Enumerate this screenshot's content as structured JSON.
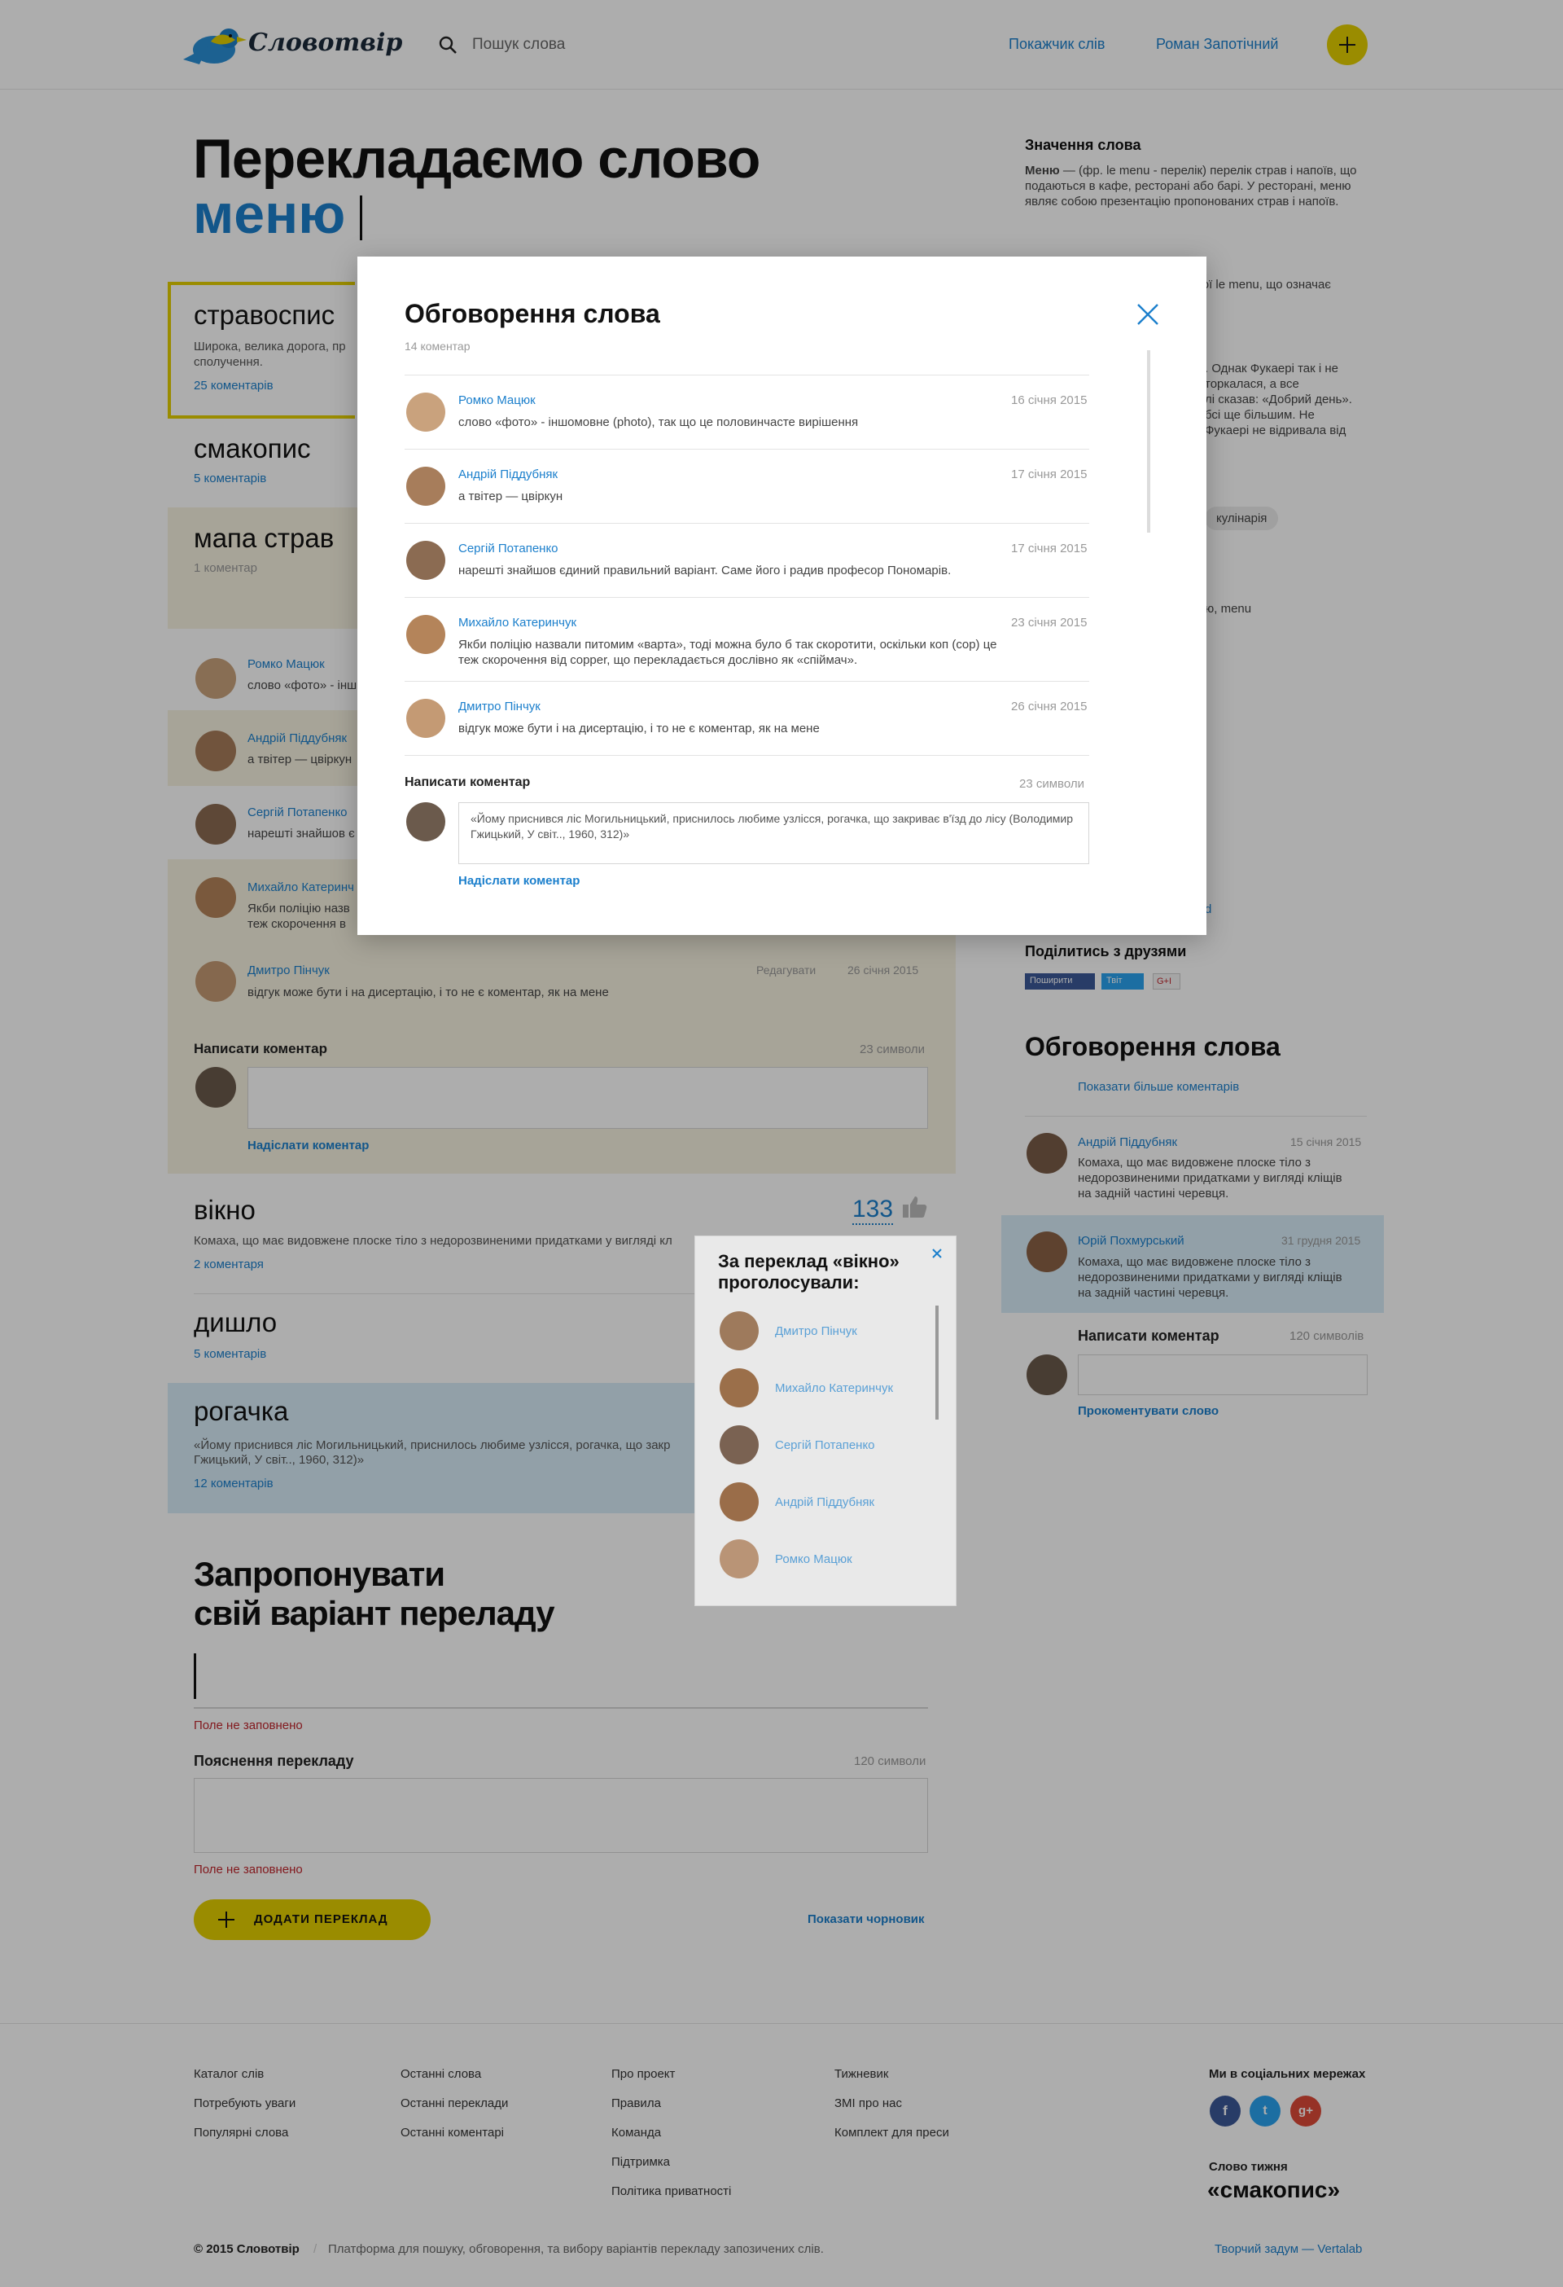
{
  "header": {
    "logo_text": "Словотвір",
    "search_placeholder": "Пошук слова",
    "nav": [
      "Покажчик слів",
      "Роман Запотічний"
    ]
  },
  "main": {
    "title_line1": "Перекладаємо слово",
    "title_word": "меню",
    "cards": [
      {
        "title": "стравоспис",
        "desc": "Широка, велика дорога, пр",
        "desc2": "сполучення.",
        "link": "25 коментарів"
      },
      {
        "title": "смакопис",
        "link": "5 коментарів"
      },
      {
        "title": "мапа страв",
        "link": "1 коментар"
      }
    ],
    "expanded_comments": [
      {
        "name": "Ромко Мацюк",
        "text": "слово «фото» - інш"
      },
      {
        "name": "Андрій Піддубняк",
        "text": "а твітер — цвіркун"
      },
      {
        "name": "Сергій Потапенко",
        "text": "нарешті знайшов є"
      },
      {
        "name": "Михайло Катеринч",
        "text": "Якби поліцію назв",
        "text2": "теж скорочення в"
      },
      {
        "name": "Дмитро Пінчук",
        "text": "відгук може бути і на дисертацію, і то не є коментар, як на мене",
        "edit": "Редагувати",
        "date": "26 січня 2015"
      }
    ],
    "write_comment_label": "Написати коментар",
    "write_comment_counter": "23 символи",
    "send_comment": "Надіслати коментар",
    "cards2": [
      {
        "title": "вікно",
        "desc": "Комаха, що має видовжене плоске тіло з недорозвиненими придатками у вигляді кл",
        "link": "2 коментаря",
        "votes": "133"
      },
      {
        "title": "дишло",
        "link": "5 коментарів"
      },
      {
        "title": "рогачка",
        "desc": "«Йому приснився ліс Могильницький, приснилось любиме узлісся, рогачка, що закр",
        "desc2": "Гжицький, У світ.., 1960, 312)»",
        "link": "12 коментарів"
      }
    ],
    "propose_title1": "Запропонувати",
    "propose_title2": "свій варіант переладу",
    "field_error": "Поле не заповнено",
    "explain_label": "Пояснення перекладу",
    "explain_counter": "120 символи",
    "add_button": "ДОДАТИ ПЕРЕКЛАД",
    "show_draft": "Показати чорновик"
  },
  "sidebar": {
    "meaning_title": "Значення слова",
    "meaning_bold": "Меню",
    "meaning_text": " — (фр. le menu - перелік) перелік страв і напоїв, що подаються в кафе, ресторані або барі. У ресторані, меню являє собою презентацію пропонованих страв і напоїв.",
    "frag1": "кої le menu, що означає",
    "frag2a": ". Однак Фукаері так і не",
    "frag2b": "торкалася, а все",
    "frag2c": "лі сказав: «Добрий день».",
    "frag2d": "бсі ще більшим. Не",
    "frag2e": "Фукаері не відривала від",
    "tag": "кулінарія",
    "frag3": "ю, menu",
    "frag4": "d",
    "share_title": "Поділитись з друзями",
    "share_buttons": [
      "Поширити",
      "Твіт",
      "G+I"
    ],
    "discussion_title": "Обговорення слова",
    "show_more": "Показати більше коментарів",
    "comments": [
      {
        "name": "Андрій Піддубняк",
        "date": "15 січня 2015",
        "text": [
          "Комаха, що має видовжене плоске тіло з",
          "недорозвиненими придатками у вигляді кліщів",
          "на задній частині черевця."
        ]
      },
      {
        "name": "Юрій Похмурський",
        "date": "31 грудня 2015",
        "text": [
          "Комаха, що має видовжене плоске тіло з",
          "недорозвиненими придатками у вигляді кліщів",
          "на задній частині черевця."
        ]
      }
    ],
    "write_label": "Написати коментар",
    "write_counter": "120 символів",
    "comment_word": "Прокоментувати слово"
  },
  "popover": {
    "title1": "За переклад «вікно»",
    "title2": "проголосували:",
    "voters": [
      "Дмитро Пінчук",
      "Михайло Катеринчук",
      "Сергій Потапенко",
      "Андрій Піддубняк",
      "Ромко Мацюк"
    ]
  },
  "modal": {
    "title": "Обговорення слова",
    "count": "14 коментар",
    "comments": [
      {
        "name": "Ромко Мацюк",
        "date": "16 січня 2015",
        "text": [
          "слово «фото» - іншомовне (photo), так що це половинчасте вирішення"
        ]
      },
      {
        "name": "Андрій Піддубняк",
        "date": "17 січня 2015",
        "text": [
          "а твітер — цвіркун"
        ]
      },
      {
        "name": "Сергій Потапенко",
        "date": "17 січня 2015",
        "text": [
          "нарешті знайшов єдиний правильний варіант. Саме його і радив професор Пономарів."
        ]
      },
      {
        "name": "Михайло Катеринчук",
        "date": "23 січня 2015",
        "text": [
          "Якби поліцію назвали питомим «варта», тоді можна було б так скоротити, оскільки коп (cop) це",
          "теж скорочення від copper, що перекладається дослівно як «спіймач»."
        ]
      },
      {
        "name": "Дмитро Пінчук",
        "date": "26 січня 2015",
        "text": [
          "відгук може бути і на дисертацію, і то не є коментар, як на мене"
        ]
      }
    ],
    "write_label": "Написати коментар",
    "write_counter": "23 символи",
    "input_value": "«Йому приснився ліс Могильницький, приснилось любиме узлісся, рогачка, що закриває в'їзд до лісу (Володимир Гжицький, У світ.., 1960, 312)»",
    "send": "Надіслати коментар"
  },
  "footer": {
    "col1": [
      "Каталог слів",
      "Потребують уваги",
      "Популярні слова"
    ],
    "col2": [
      "Останні слова",
      "Останні переклади",
      "Останні коментарі"
    ],
    "col3": [
      "Про проект",
      "Правила",
      "Команда",
      "Підтримка",
      "Політика приватності"
    ],
    "col4": [
      "Тижневик",
      "ЗМІ про нас",
      "Комплект для преси"
    ],
    "social_title": "Ми в соціальних мережах",
    "social": [
      "f",
      "t",
      "g+"
    ],
    "word_week_label": "Слово тижня",
    "word_week": "«смакопис»",
    "copyright": "© 2015 Словотвір",
    "tagline": "Платформа для пошуку, обговорення, та вибору варіантів перекладу запозичених слів.",
    "credit": "Творчий задум — Vertalab"
  },
  "colors": {
    "accent": "#1b7fcc",
    "yellow": "#e4cf00",
    "error": "#c0262d"
  }
}
